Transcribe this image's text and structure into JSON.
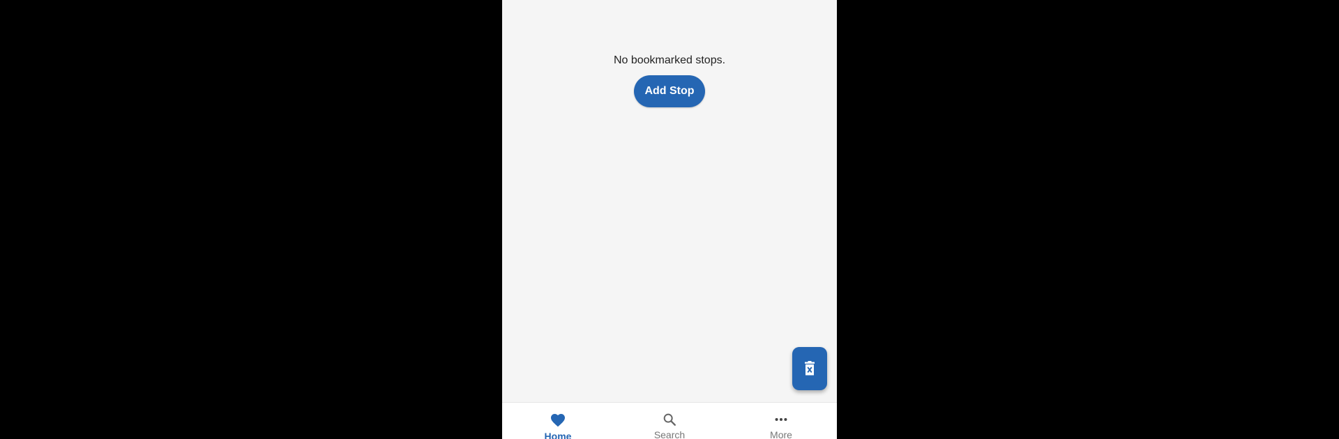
{
  "home": {
    "empty_message": "No bookmarked stops.",
    "add_stop_label": "Add Stop"
  },
  "fab": {
    "icon": "delete-icon"
  },
  "bottom_nav": {
    "items": [
      {
        "label": "Home",
        "icon": "heart-icon",
        "active": true
      },
      {
        "label": "Search",
        "icon": "search-icon",
        "active": false
      },
      {
        "label": "More",
        "icon": "more-icon",
        "active": false
      }
    ]
  },
  "colors": {
    "primary": "#2566b3",
    "background": "#f5f5f5",
    "inactive": "#777777"
  }
}
